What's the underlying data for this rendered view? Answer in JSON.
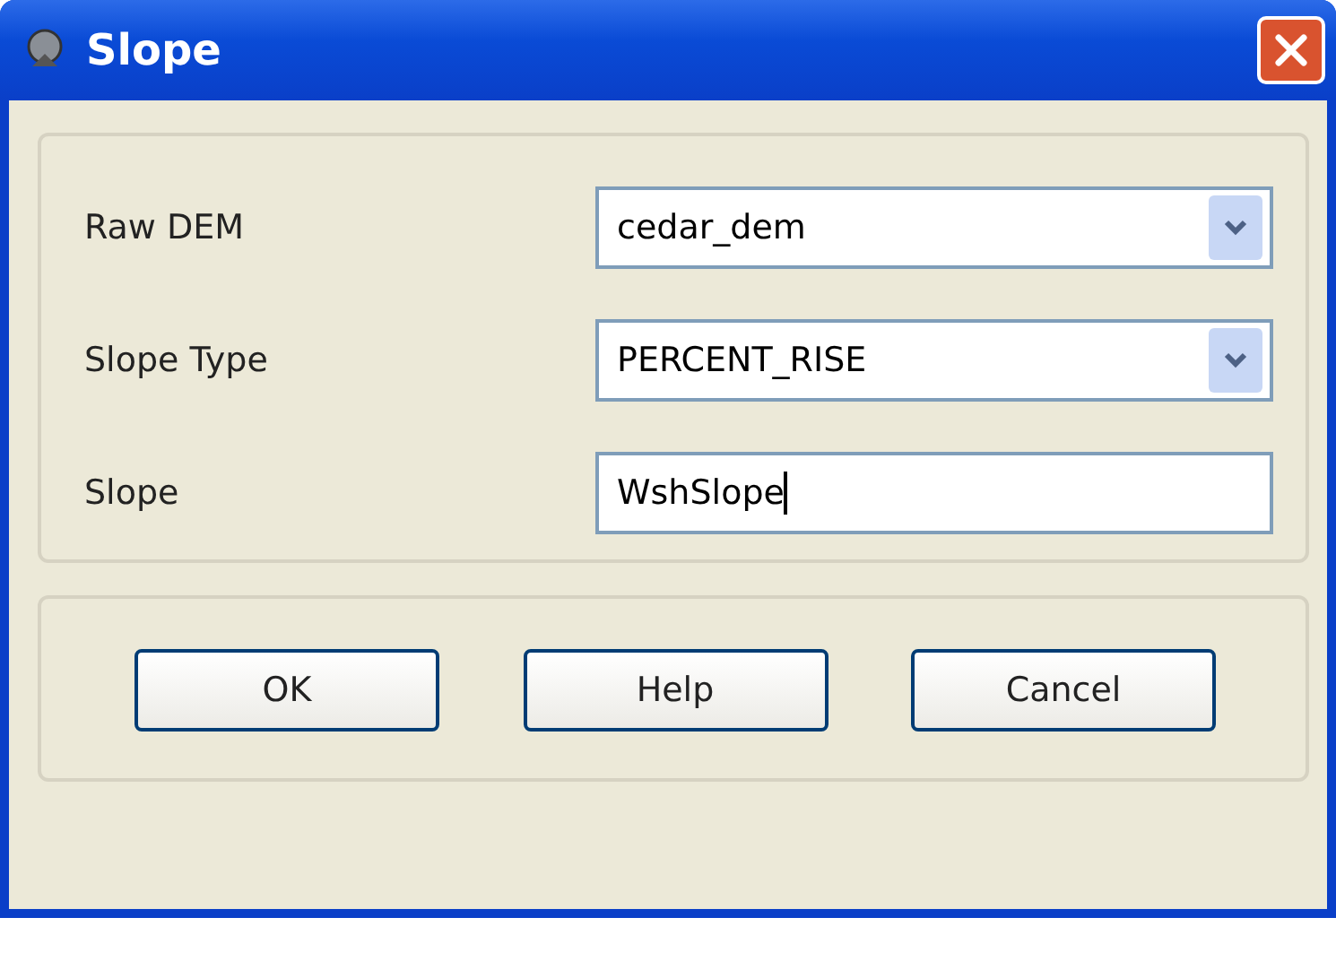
{
  "window": {
    "title": "Slope"
  },
  "fields": [
    {
      "label": "Raw DEM",
      "kind": "combo",
      "value": "cedar_dem"
    },
    {
      "label": "Slope Type",
      "kind": "combo",
      "value": "PERCENT_RISE"
    },
    {
      "label": "Slope",
      "kind": "text",
      "value": "WshSlope"
    }
  ],
  "buttons": [
    "OK",
    "Help",
    "Cancel"
  ]
}
